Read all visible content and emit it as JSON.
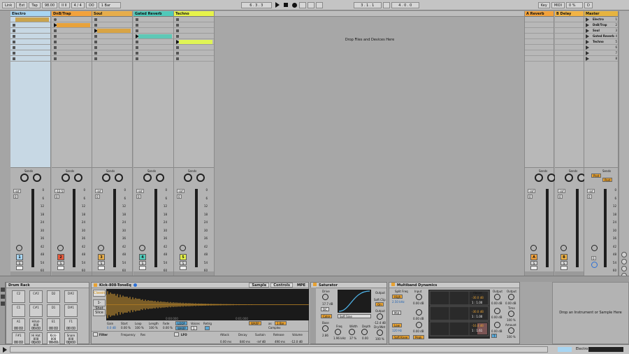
{
  "toolbar": {
    "link": "Link",
    "ext": "Ext",
    "tap": "Tap",
    "tempo": "98.00",
    "bars": "II II",
    "sig": "4 / 4",
    "monitor": "OO",
    "quant": "1 Bar",
    "pos": "6 . 3 . 3",
    "loop_start": "3 . 1 . 1",
    "loop_len": "4 . 0 . 0",
    "key": "Key",
    "midi": "MIDI",
    "cpu": "0 %",
    "d": "D"
  },
  "colors": {
    "electro": "#a7d5f2",
    "dnb": "#f2a23c",
    "soul": "#e6ad4b",
    "gated": "#50c9b9",
    "techno": "#e6f34a",
    "ret_a": "#f2a23c",
    "ret_b": "#f2b445",
    "master": "#e6b440",
    "clip_dnb": "#e8a23b",
    "clip_soul": "#d8a445",
    "clip_gated": "#5ec8b6",
    "clip_techno": "#e0f455"
  },
  "tracks": [
    {
      "name": "Electro",
      "num": "1",
      "vol": "-inf",
      "pan": "0",
      "sends": "Sends",
      "solo": "S",
      "track": "6"
    },
    {
      "name": "DnB/Trap",
      "num": "2",
      "vol": "-12.5",
      "pan": "0",
      "sends": "Sends",
      "solo": "S",
      "track": "6",
      "extra": "2"
    },
    {
      "name": "Soul",
      "num": "3",
      "vol": "-inf",
      "pan": "0",
      "sends": "Sends",
      "solo": "S",
      "track": "6"
    },
    {
      "name": "Gated Reverb",
      "num": "4",
      "vol": "-inf",
      "pan": "0",
      "sends": "Sends",
      "solo": "S",
      "track": "6"
    },
    {
      "name": "Techno",
      "num": "5",
      "vol": "-inf",
      "pan": "0",
      "sends": "Sends",
      "solo": "S",
      "track": "6"
    }
  ],
  "returns": [
    {
      "name": "A Reverb",
      "num": "A",
      "vol": "-inf",
      "pan": "0",
      "sends": "Sends",
      "solo": "S"
    },
    {
      "name": "B Delay",
      "num": "B",
      "vol": "-inf",
      "pan": "0",
      "sends": "Sends",
      "solo": "S"
    }
  ],
  "master": {
    "name": "Master",
    "vol": "-inf",
    "pan": "0",
    "sends": "Sends",
    "post": "Post",
    "cue": "0",
    "scenes": [
      "Electro",
      "DnB/Trap",
      "Soul",
      "Gated Reverb",
      "Techno"
    ],
    "scene_nums": [
      "1",
      "2",
      "3",
      "4",
      "5",
      "6",
      "7",
      "8"
    ]
  },
  "scale": [
    "0",
    "6",
    "12",
    "18",
    "24",
    "30",
    "36",
    "42",
    "48",
    "54",
    "60"
  ],
  "drop_area": "Drop Files and Devices Here",
  "drop_instrument": "Drop an Instrument or Sample Here",
  "drumrack": {
    "title": "Drum Rack",
    "pads": [
      "C2",
      "C#2",
      "D2",
      "D#2",
      "C1",
      "C#1",
      "D1",
      "D#1",
      "A1",
      "Hihat-808 Closed",
      "E1",
      "F1",
      "F#1",
      "Hi Hat 808 Open",
      "Kick-808 ToneEq",
      "Snare 808 Tight 4"
    ],
    "m": "M",
    "s": "S"
  },
  "simpler": {
    "title": "Kick-808-ToneEq",
    "tabs": [
      "Sample",
      "Controls"
    ],
    "mpe": "MPE",
    "classic": "Classic",
    "mode1": "1-Shot",
    "mode2": "Slice",
    "gain_l": "Gain",
    "gain_v": "0.0 dB",
    "start_l": "Start",
    "start_v": "0.00 %",
    "loop_l": "Loop",
    "loop_v": "100 %",
    "length_l": "Length",
    "length_v": "100 %",
    "fade_l": "Fade",
    "fade_v": "0.00 %",
    "loop_btn": "LOOP",
    "voices_l": "Voices",
    "voices_v": "1",
    "retrig_l": "Retrig",
    "warp": "WARP",
    "as": "as",
    "bars": "1 Bar",
    "complex": "Complex",
    "filter": "Filter",
    "freq_l": "Frequency",
    "res_l": "Res",
    "lfo": "LFO",
    "attack_l": "Attack",
    "attack_v": "0.00 ms",
    "decay_l": "Decay",
    "decay_v": "840 ms",
    "sustain_l": "Sustain",
    "sustain_v": "-inf dB",
    "release_l": "Release",
    "release_v": "490 ms",
    "volume_l": "Volume",
    "volume_v": "-12.0 dB",
    "t1": "0:00:000",
    "t2": "0:01:000"
  },
  "saturator": {
    "title": "Saturator",
    "drive_l": "Drive",
    "drive_v": "17.7 dB",
    "dc": "DC",
    "color": "Color",
    "softsine": "Soft Sine",
    "base_l": "Base",
    "base_v": "2.86",
    "freq_l": "Freq",
    "freq_v": "1.96 kHz",
    "width_l": "Width",
    "width_v": "37 %",
    "depth_l": "Depth",
    "depth_v": "0.00",
    "output_l": "Output",
    "softclip_l": "Soft Clip",
    "on": "On",
    "out_l": "Output",
    "out_v": "-12.4 dB",
    "drywet_l": "Dry/Wet",
    "drywet_v": "100 %"
  },
  "multiband": {
    "title": "Multiband Dynamics",
    "split_l": "Split Freq",
    "high": "High",
    "high_v": "2.50 kHz",
    "input_l": "Input",
    "input_v1": "0.00 dB",
    "mid": "Mid",
    "input_v2": "0.00 dB",
    "low": "Low",
    "low_v": "120 Hz",
    "input_v3": "0.00 dB",
    "softknee": "Soft Knee",
    "peak": "Peak",
    "above": "Above",
    "a1": "-30.0 dB",
    "r1": "1 : 1.00",
    "a2": "-30.0 dB",
    "r2": "1 : 1.00",
    "a3": "-16.4 dB",
    "r3": "1 : 1.61",
    "output_l": "Output",
    "o1": "0.00 dB",
    "o2": "0.00 dB",
    "o3": "0.00 dB",
    "out_l": "Output",
    "out_v": "0.00 dB",
    "time_l": "Time",
    "time_v": "100 %",
    "amount_l": "Amount",
    "amount_v": "100 %",
    "t": "T"
  },
  "statusbar": {
    "electro": "Electro"
  }
}
